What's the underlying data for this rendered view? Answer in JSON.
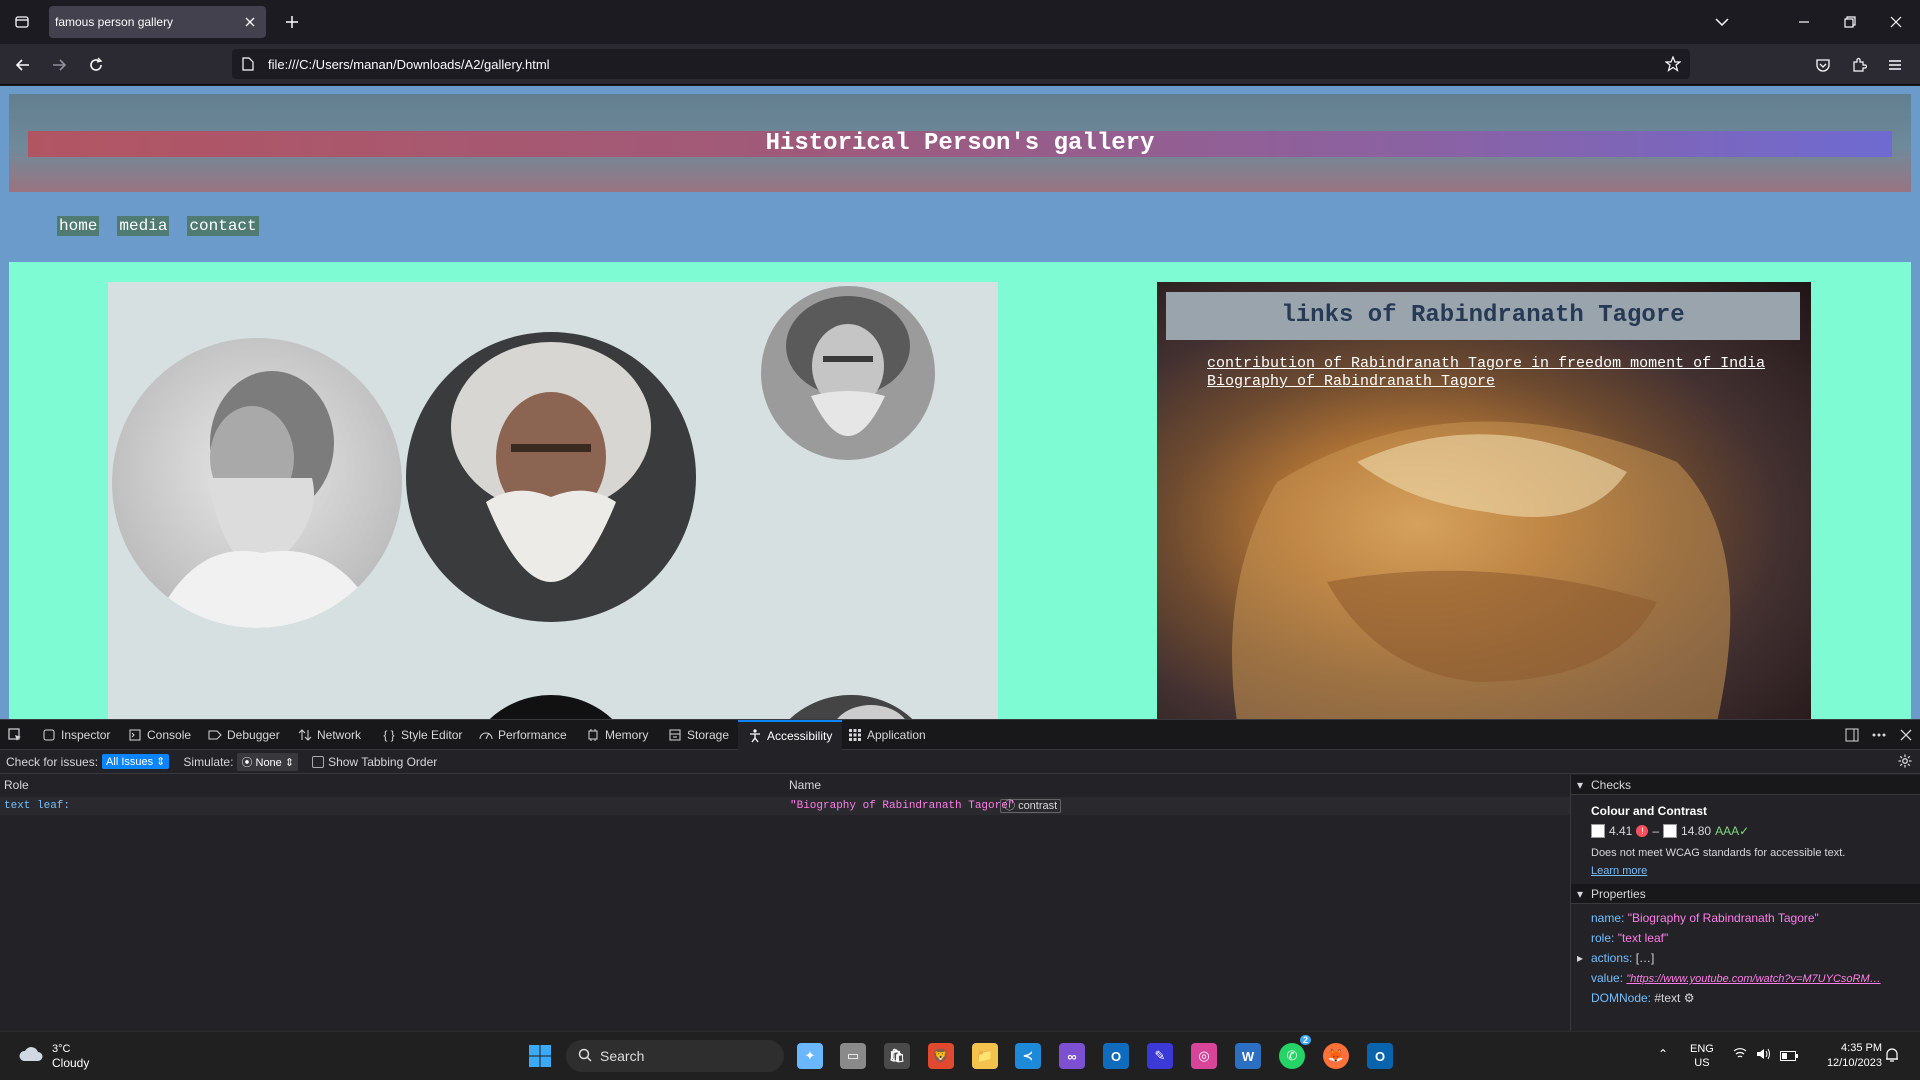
{
  "browser": {
    "tab_title": "famous person gallery",
    "url": "file:///C:/Users/manan/Downloads/A2/gallery.html"
  },
  "page": {
    "banner_title": "Historical Person's gallery",
    "menu": [
      {
        "label": "home"
      },
      {
        "label": "media"
      },
      {
        "label": "contact"
      }
    ],
    "links_panel": {
      "title": "links of Rabindranath Tagore",
      "links": [
        {
          "label": "contribution of Rabindranath Tagore in freedom moment of India"
        },
        {
          "label": "Biography of Rabindranath Tagore"
        }
      ]
    }
  },
  "devtools": {
    "tabs": [
      {
        "label": "Inspector",
        "icon": "inspector-icon"
      },
      {
        "label": "Console",
        "icon": "console-icon"
      },
      {
        "label": "Debugger",
        "icon": "debugger-icon"
      },
      {
        "label": "Network",
        "icon": "network-icon"
      },
      {
        "label": "Style Editor",
        "icon": "style-editor-icon"
      },
      {
        "label": "Performance",
        "icon": "performance-icon"
      },
      {
        "label": "Memory",
        "icon": "memory-icon"
      },
      {
        "label": "Storage",
        "icon": "storage-icon"
      },
      {
        "label": "Accessibility",
        "icon": "accessibility-icon",
        "active": true
      },
      {
        "label": "Application",
        "icon": "application-icon"
      }
    ],
    "toolbar": {
      "check_label": "Check for issues:",
      "check_value": "All Issues",
      "simulate_label": "Simulate:",
      "simulate_value": "None",
      "tabbing_label": "Show Tabbing Order"
    },
    "tree": {
      "col_role": "Role",
      "col_name": "Name",
      "row_role": "text leaf:",
      "row_name": "\"Biography of Rabindranath Tagore\"",
      "row_badge": "contrast"
    },
    "checks": {
      "header": "Checks",
      "title": "Colour and Contrast",
      "ratio1": "4.41",
      "ratio2": "14.80",
      "rating2": "AAA✓",
      "message": "Does not meet WCAG standards for accessible text.",
      "learn_more": "Learn more"
    },
    "properties": {
      "header": "Properties",
      "name_key": "name:",
      "name_val": "\"Biography of Rabindranath Tagore\"",
      "role_key": "role:",
      "role_val": "\"text leaf\"",
      "actions_key": "actions:",
      "actions_val": "[…]",
      "value_key": "value:",
      "value_val": "\"https://www.youtube.com/watch?v=M7UYCsoRM…",
      "domnode_key": "DOMNode:",
      "domnode_val": "#text"
    }
  },
  "taskbar": {
    "weather_temp": "3°C",
    "weather_desc": "Cloudy",
    "search_placeholder": "Search",
    "lang": "ENG",
    "region": "US",
    "time": "4:35 PM",
    "date": "12/10/2023",
    "whatsapp_badge": "2"
  },
  "colors": {
    "page_bg": "#6a9bcb",
    "content_bg": "#7ffbd3",
    "gallery_bg": "#d6e0e0",
    "accent": "#0a84ff"
  }
}
